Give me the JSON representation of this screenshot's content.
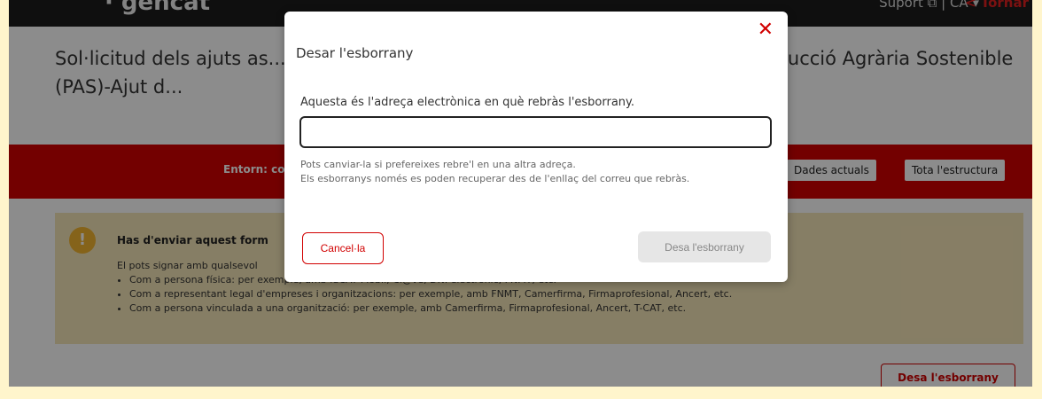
{
  "header": {
    "logo": "· gencat",
    "links": "Suport ⧉  |  CA ▾",
    "back": "< Tornar"
  },
  "page": {
    "title": "Sol·licitud dels ajuts as... nya 2025-2026 (Ajut al Càlcul del perfil de sos... Producció Agrària Sostenible (PAS)-Ajut d...",
    "env_label": "Entorn: co",
    "btn_dades": "Dades actuals",
    "btn_tota": "Tota l'estructura",
    "save_draft": "Desa l'esborrany"
  },
  "warning": {
    "title": "Has d'enviar aquest form",
    "line1": "El pots signar amb qualsevol",
    "items": [
      "Com a persona física: per exemple, amb idCAT Mòbil, Cl@ve, DNI electrònic, FNMT, etc.",
      "Com a representant legal d'empreses i organitzacions: per exemple, amb FNMT, Camerfirma, Firmaprofesional, Ancert, etc.",
      "Com a persona vinculada a una organització: per exemple, amb Camerfirma, Firmaprofesional, Ancert, T-CAT, etc."
    ]
  },
  "modal": {
    "title": "Desar l'esborrany",
    "label": "Aquesta és l'adreça electrònica en què rebràs l'esborrany.",
    "email_value": "",
    "hint1": "Pots canviar-la si prefereixes rebre'l en una altra adreça.",
    "hint2": "Els esborranys només es poden recuperar des de l'enllaç del correu que rebràs.",
    "cancel": "Cancel·la",
    "save": "Desa l'esborrany",
    "close": "✕"
  }
}
